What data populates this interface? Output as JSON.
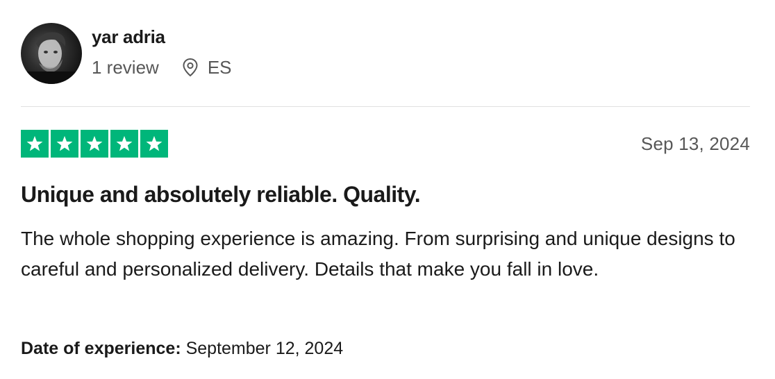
{
  "reviewer": {
    "name": "yar adria",
    "review_count": "1 review",
    "country": "ES"
  },
  "review": {
    "rating": 5,
    "max_rating": 5,
    "star_color": "#00b67a",
    "date": "Sep 13, 2024",
    "title": "Unique and absolutely reliable. Quality.",
    "body": "The whole shopping experience is amazing. From surprising and unique designs to careful and personalized delivery. Details that make you fall in love.",
    "experience_label": "Date of experience:",
    "experience_date": "September 12, 2024"
  },
  "icons": {
    "location": "location-pin-icon",
    "star": "star-icon"
  }
}
